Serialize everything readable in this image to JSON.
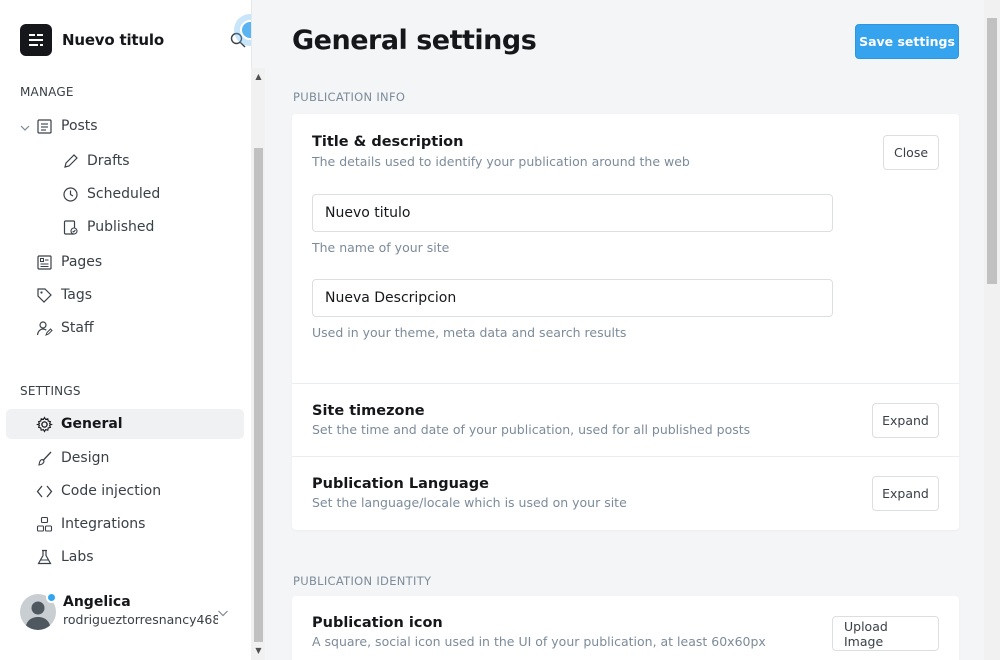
{
  "brand": {
    "name": "Nuevo titulo"
  },
  "sidebar": {
    "manage_label": "MANAGE",
    "settings_label": "SETTINGS",
    "manage_items": [
      {
        "label": "Posts",
        "icon": "posts-icon"
      },
      {
        "label": "Drafts",
        "icon": "pencil-icon"
      },
      {
        "label": "Scheduled",
        "icon": "clock-icon"
      },
      {
        "label": "Published",
        "icon": "published-icon"
      },
      {
        "label": "Pages",
        "icon": "pages-icon"
      },
      {
        "label": "Tags",
        "icon": "tag-icon"
      },
      {
        "label": "Staff",
        "icon": "staff-icon"
      }
    ],
    "settings_items": [
      {
        "label": "General",
        "icon": "gear-icon",
        "active": true
      },
      {
        "label": "Design",
        "icon": "brush-icon"
      },
      {
        "label": "Code injection",
        "icon": "code-icon"
      },
      {
        "label": "Integrations",
        "icon": "integrations-icon"
      },
      {
        "label": "Labs",
        "icon": "flask-icon"
      }
    ],
    "user": {
      "name": "Angelica",
      "email": "rodrigueztorresnancy468..."
    }
  },
  "main": {
    "title": "General settings",
    "save_label": "Save settings",
    "publication_info_label": "PUBLICATION INFO",
    "publication_identity_label": "PUBLICATION IDENTITY",
    "title_desc": {
      "title": "Title & description",
      "desc": "The details used to identify your publication around the web",
      "close_label": "Close",
      "site_title_value": "Nuevo titulo",
      "site_title_hint": "The name of your site",
      "site_desc_value": "Nueva Descripcion",
      "site_desc_hint": "Used in your theme, meta data and search results"
    },
    "timezone": {
      "title": "Site timezone",
      "desc": "Set the time and date of your publication, used for all published posts",
      "button_label": "Expand"
    },
    "language": {
      "title": "Publication Language",
      "desc": "Set the language/locale which is used on your site",
      "button_label": "Expand"
    },
    "icon": {
      "title": "Publication icon",
      "desc": "A square, social icon used in the UI of your publication, at least 60x60px",
      "button_label": "Upload Image"
    }
  },
  "colors": {
    "accent": "#36a3ee",
    "active_bg": "#eff1f3",
    "text": "#15171a",
    "muted": "#7c8b9a"
  }
}
